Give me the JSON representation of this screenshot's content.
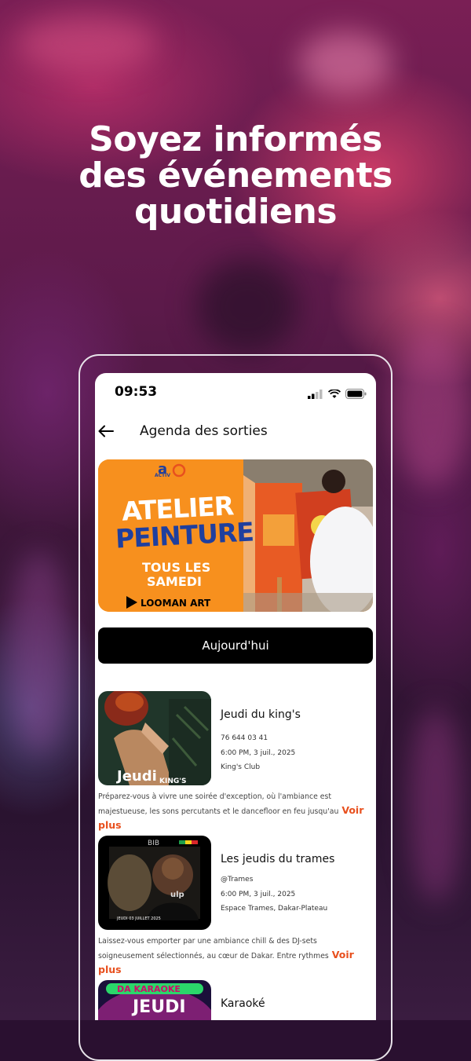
{
  "headline": [
    "Soyez informés",
    "des événements",
    "quotidiens"
  ],
  "status_bar": {
    "time": "09:53"
  },
  "appbar": {
    "title": "Agenda des sorties"
  },
  "banner": {
    "logo_text": "ACTIV",
    "title_line1": "ATELIER",
    "title_line2": "PEINTURE",
    "subtitle_line1": "TOUS LES",
    "subtitle_line2": "SAMEDI",
    "brand": "LOOMAN ART"
  },
  "filter_button": "Aujourd'hui",
  "events": [
    {
      "title": "Jeudi du king's",
      "phone": "76 644 03 41",
      "datetime": "6:00 PM, 3 juil., 2025",
      "venue": "King's Club",
      "description": "Préparez-vous à vivre une soirée d'exception, où l'ambiance est majestueuse, les sons percutants et le dancefloor en feu jusqu'au",
      "more": "Voir plus",
      "thumb_text": "Jeudi",
      "thumb_small": "KING'S"
    },
    {
      "title": "Les jeudis du trames",
      "phone": "@Trames",
      "datetime": "6:00 PM, 3 juil., 2025",
      "venue": "Espace Trames, Dakar-Plateau",
      "description": "Laissez-vous emporter par une ambiance chill & des DJ-sets soigneusement sélectionnés, au cœur de Dakar. Entre rythmes",
      "more": "Voir plus",
      "thumb_top": "BIB",
      "thumb_bottom": "JEUDI 03 JUILLET 2025"
    },
    {
      "title": "Karaoké",
      "thumb_top": "DA KARAOKE",
      "thumb_text": "JEUDI"
    }
  ],
  "colors": {
    "accent": "#e8501e",
    "banner_orange": "#f7901e",
    "banner_blue": "#1f3f9e"
  }
}
